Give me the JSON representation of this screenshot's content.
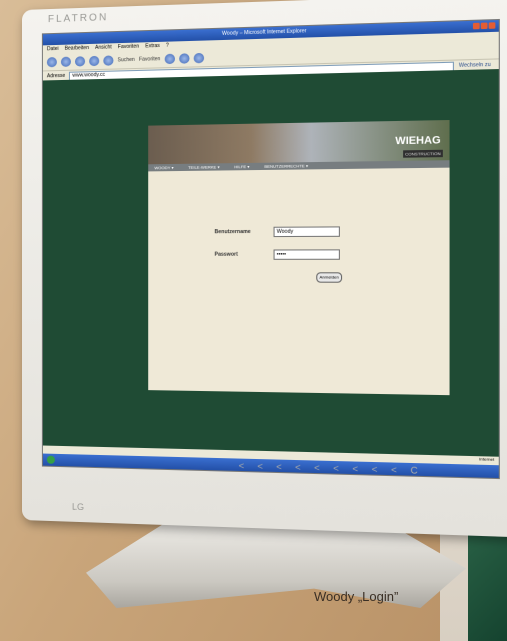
{
  "caption": "Woody „Login”",
  "monitor": {
    "brand": "FLATRON",
    "logo_text": "LG",
    "controls": "< < < < < < < < < C"
  },
  "browser": {
    "title": "Woody – Microsoft Internet Explorer",
    "menu": [
      "Datei",
      "Bearbeiten",
      "Ansicht",
      "Favoriten",
      "Extras",
      "?"
    ],
    "toolbar": {
      "search_label": "Suchen",
      "favorites_label": "Favoriten"
    },
    "address_label": "Adresse",
    "address_value": "www.woody.cc",
    "go_label": "Wechseln zu",
    "status_text": "Internet"
  },
  "page": {
    "banner_logo": "WIEHAG",
    "banner_tag": "CONSTRUCTION",
    "nav": [
      "WOODY ▾",
      "TEILE-WERKE ▾",
      "HILFE ▾",
      "BENUTZERRECHTE ▾"
    ],
    "form": {
      "username_label": "Benutzername",
      "username_value": "Woody",
      "password_label": "Passwort",
      "password_value": "•••••",
      "submit_label": "Anmelden"
    }
  }
}
